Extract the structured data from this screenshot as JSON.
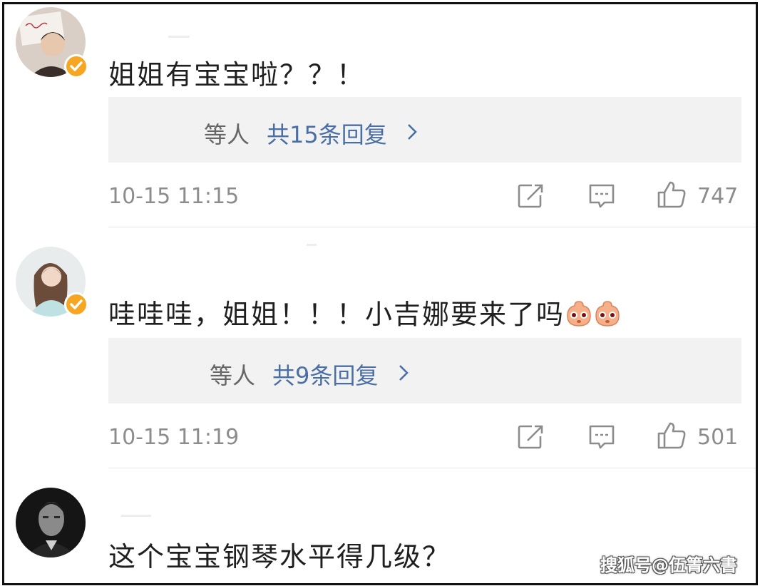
{
  "comments": [
    {
      "text": "姐姐有宝宝啦？？！",
      "replies_who": "等人",
      "replies_count": "共15条回复",
      "time": "10-15 11:15",
      "likes": "747"
    },
    {
      "text": "哇哇哇，姐姐！！！小吉娜要来了吗",
      "emoji_names": [
        "cute-face-emoji",
        "cute-face-emoji"
      ],
      "replies_who": "等人",
      "replies_count": "共9条回复",
      "time": "10-15 11:19",
      "likes": "501"
    },
    {
      "text": "这个宝宝钢琴水平得几级？"
    }
  ],
  "icons": {
    "chevron": "chevron-right-icon",
    "share": "repost-icon",
    "comment": "comment-icon",
    "like": "thumbs-up-icon",
    "verified": "verified-badge-icon"
  },
  "colors": {
    "link": "#4a6fa5",
    "text": "#1f1f1f",
    "meta": "#8c8c8c",
    "reply_bg": "#f2f2f2",
    "verified": "#f6a623"
  },
  "watermark": "搜狐号@伍箐六書"
}
